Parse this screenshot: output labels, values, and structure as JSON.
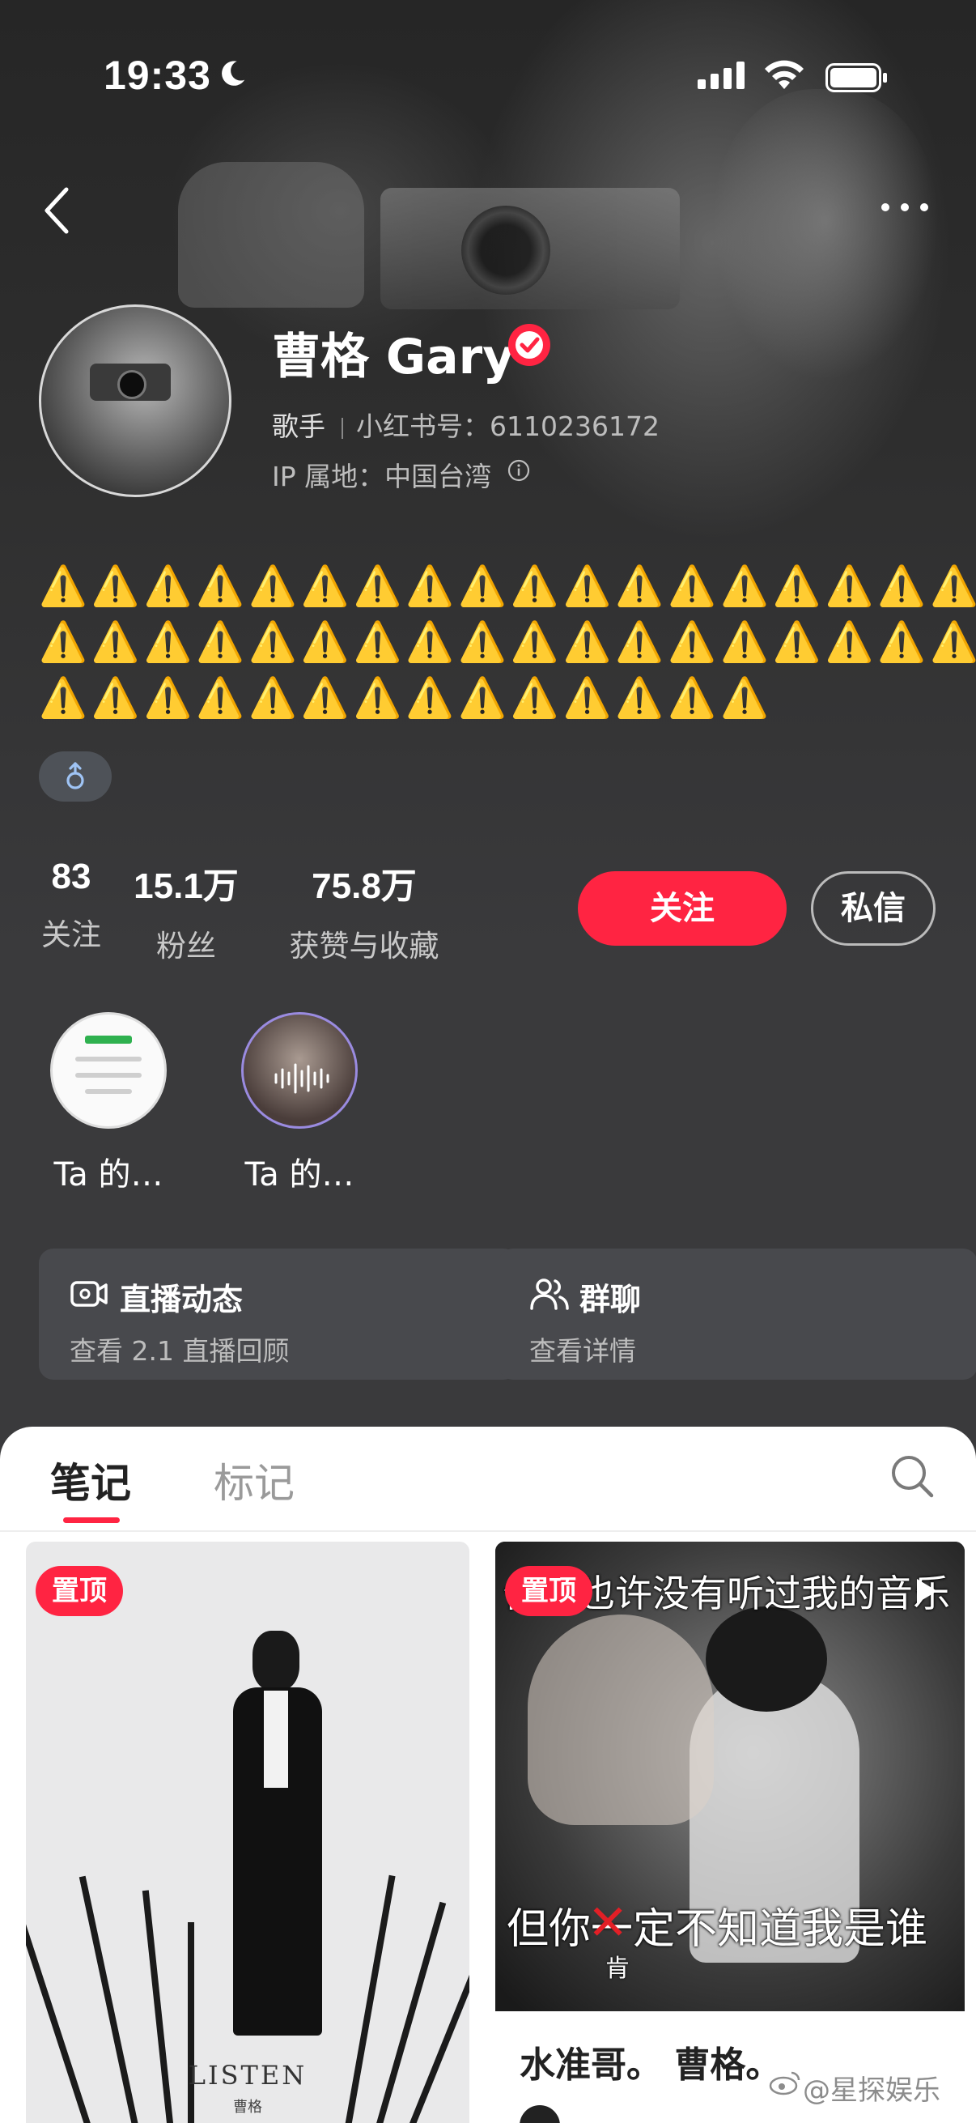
{
  "status_bar": {
    "time": "19:33"
  },
  "profile": {
    "name": "曹格 Gary",
    "occupation": "歌手",
    "red_id": "小红书号：6110236172",
    "ip_location": "IP 属地：中国台湾",
    "bio": "⚠️⚠️⚠️⚠️⚠️⚠️⚠️⚠️⚠️⚠️⚠️⚠️⚠️⚠️⚠️⚠️⚠️⚠️⚠️⚠️⚠️⚠️⚠️⚠️⚠️⚠️⚠️⚠️⚠️⚠️⚠️⚠️⚠️⚠️⚠️⚠️⚠️⚠️⚠️⚠️⚠️⚠️⚠️⚠️⚠️⚠️⚠️⚠️⚠️⚠️",
    "gender_symbol": "♂"
  },
  "stats": [
    {
      "value": "83",
      "label": "关注"
    },
    {
      "value": "15.1万",
      "label": "粉丝"
    },
    {
      "value": "75.8万",
      "label": "获赞与收藏"
    }
  ],
  "actions": {
    "follow": "关注",
    "message": "私信"
  },
  "collections": [
    {
      "label": "Ta 的…"
    },
    {
      "label": "Ta 的…"
    }
  ],
  "cards": [
    {
      "title": "直播动态",
      "subtitle": "查看 2.1 直播回顾",
      "icon": "live-video-icon"
    },
    {
      "title": "群聊",
      "subtitle": "查看详情",
      "icon": "group-chat-icon"
    }
  ],
  "tabs": [
    {
      "label": "笔记"
    },
    {
      "label": "标记"
    }
  ],
  "notes": [
    {
      "badge": "置顶",
      "poster_title": "LISTEN",
      "poster_subtitle": "曹格"
    },
    {
      "badge": "置顶",
      "caption_top": "但你也许没有听过我的音乐",
      "caption_bottom": "但你一定不知道我是谁",
      "caption_fix": "肯",
      "title": "水准哥。 曹格。"
    }
  ],
  "watermark": "@星探娱乐",
  "colors": {
    "accent": "#ff2442",
    "background": "#3a3a3c",
    "card": "#48494d",
    "warning": "#ffcc00"
  }
}
